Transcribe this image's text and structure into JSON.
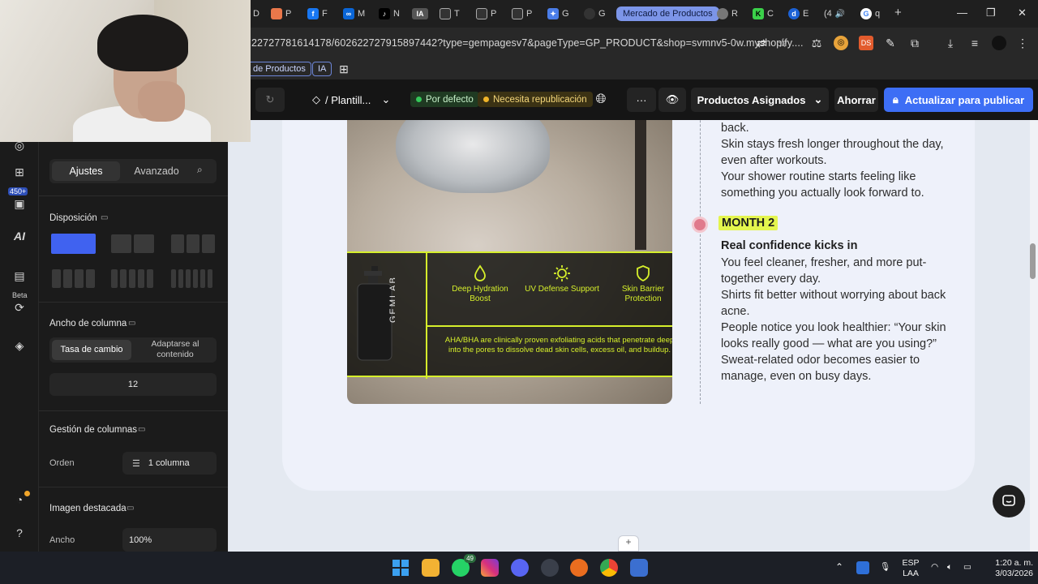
{
  "browser": {
    "tabs": [
      "D",
      "P",
      "F",
      "M",
      "N",
      "IA",
      "T",
      "P",
      "P",
      "G",
      "G",
      "Mercado de Productos",
      "R",
      "C",
      "E",
      "(4",
      "q"
    ],
    "new_tab": "+",
    "url": "22727781614178/602622727915897442?type=gempagesv7&pageType=GP_PRODUCT&shop=svmnv5-0w.myshopify....",
    "bookmarks": [
      "de Productos",
      "IA"
    ]
  },
  "editor": {
    "template_name": "/ Plantill...",
    "status_default": "Por defecto",
    "status_republish": "Necesita republicación",
    "more": "···",
    "assigned_products": "Productos Asignados",
    "save": "Ahorrar",
    "publish": "Actualizar para publicar"
  },
  "left_strip": {
    "count_badge": "450+",
    "ai_label": "AI",
    "beta_label": "Beta"
  },
  "settings": {
    "tab_settings": "Ajustes",
    "tab_advanced": "Avanzado",
    "layout_heading": "Disposición",
    "column_width_heading": "Ancho de columna",
    "column_width_opt1": "Tasa de cambio",
    "column_width_opt2": "Adaptarse al contenido",
    "column_width_value": "12",
    "column_management_heading": "Gestión de columnas",
    "order_label": "Orden",
    "order_value": "1 columna",
    "featured_image_heading": "Imagen destacada",
    "width_label": "Ancho",
    "width_value": "100%"
  },
  "product_image": {
    "features": [
      "Deep Hydration Boost",
      "UV Defense Support",
      "Skin Barrier Protection"
    ],
    "overlay_text": "AHA/BHA are clinically proven exfoliating acids that penetrate deep into the pores to dissolve dead skin cells, excess oil, and buildup.",
    "bottle_brand": "GEMLAB"
  },
  "timeline": {
    "month1_lines": [
      "Texture becomes visibly more even. Ingrown hairs reduce, especially on the chest and back.",
      "Skin stays fresh longer throughout the day, even after workouts.",
      "Your shower routine starts feeling like something you actually look forward to."
    ],
    "month2_label": "MONTH 2",
    "month2_heading": "Real confidence kicks in",
    "month2_lines": [
      "You feel cleaner, fresher, and more put-together every day.",
      "Shirts fit better without worrying about back acne.",
      "People notice you look healthier: “Your skin looks really good — what are you using?”",
      "Sweat-related odor becomes easier to manage, even on busy days."
    ]
  },
  "canvas": {
    "add_section": "+"
  },
  "taskbar": {
    "whatsapp_badge": "49",
    "lang": "ESP",
    "layout": "LAA",
    "time": "1:20 a. m.",
    "date": "3/03/2026"
  },
  "colors": {
    "accent_blue": "#3d6ef5",
    "neon_yellow": "#d6ef2b",
    "month_highlight": "#e4f54e",
    "timeline_dot": "#e07a8c"
  }
}
